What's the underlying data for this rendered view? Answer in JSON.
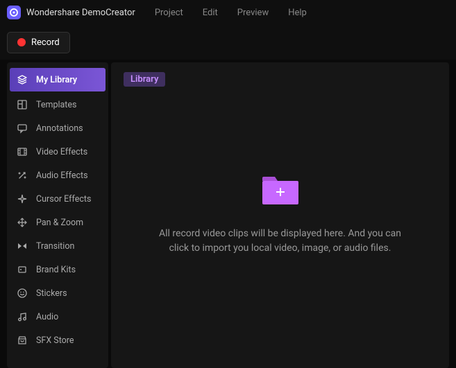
{
  "app": {
    "title": "Wondershare DemoCreator"
  },
  "menu": {
    "project": "Project",
    "edit": "Edit",
    "preview": "Preview",
    "help": "Help"
  },
  "toolbar": {
    "record_label": "Record"
  },
  "sidebar": {
    "items": [
      {
        "label": "My Library"
      },
      {
        "label": "Templates"
      },
      {
        "label": "Annotations"
      },
      {
        "label": "Video Effects"
      },
      {
        "label": "Audio Effects"
      },
      {
        "label": "Cursor Effects"
      },
      {
        "label": "Pan & Zoom"
      },
      {
        "label": "Transition"
      },
      {
        "label": "Brand Kits"
      },
      {
        "label": "Stickers"
      },
      {
        "label": "Audio"
      },
      {
        "label": "SFX Store"
      }
    ]
  },
  "main": {
    "library_tag": "Library",
    "empty_text": "All record video clips will be displayed here. And you can click to import you local video, image, or audio files."
  }
}
